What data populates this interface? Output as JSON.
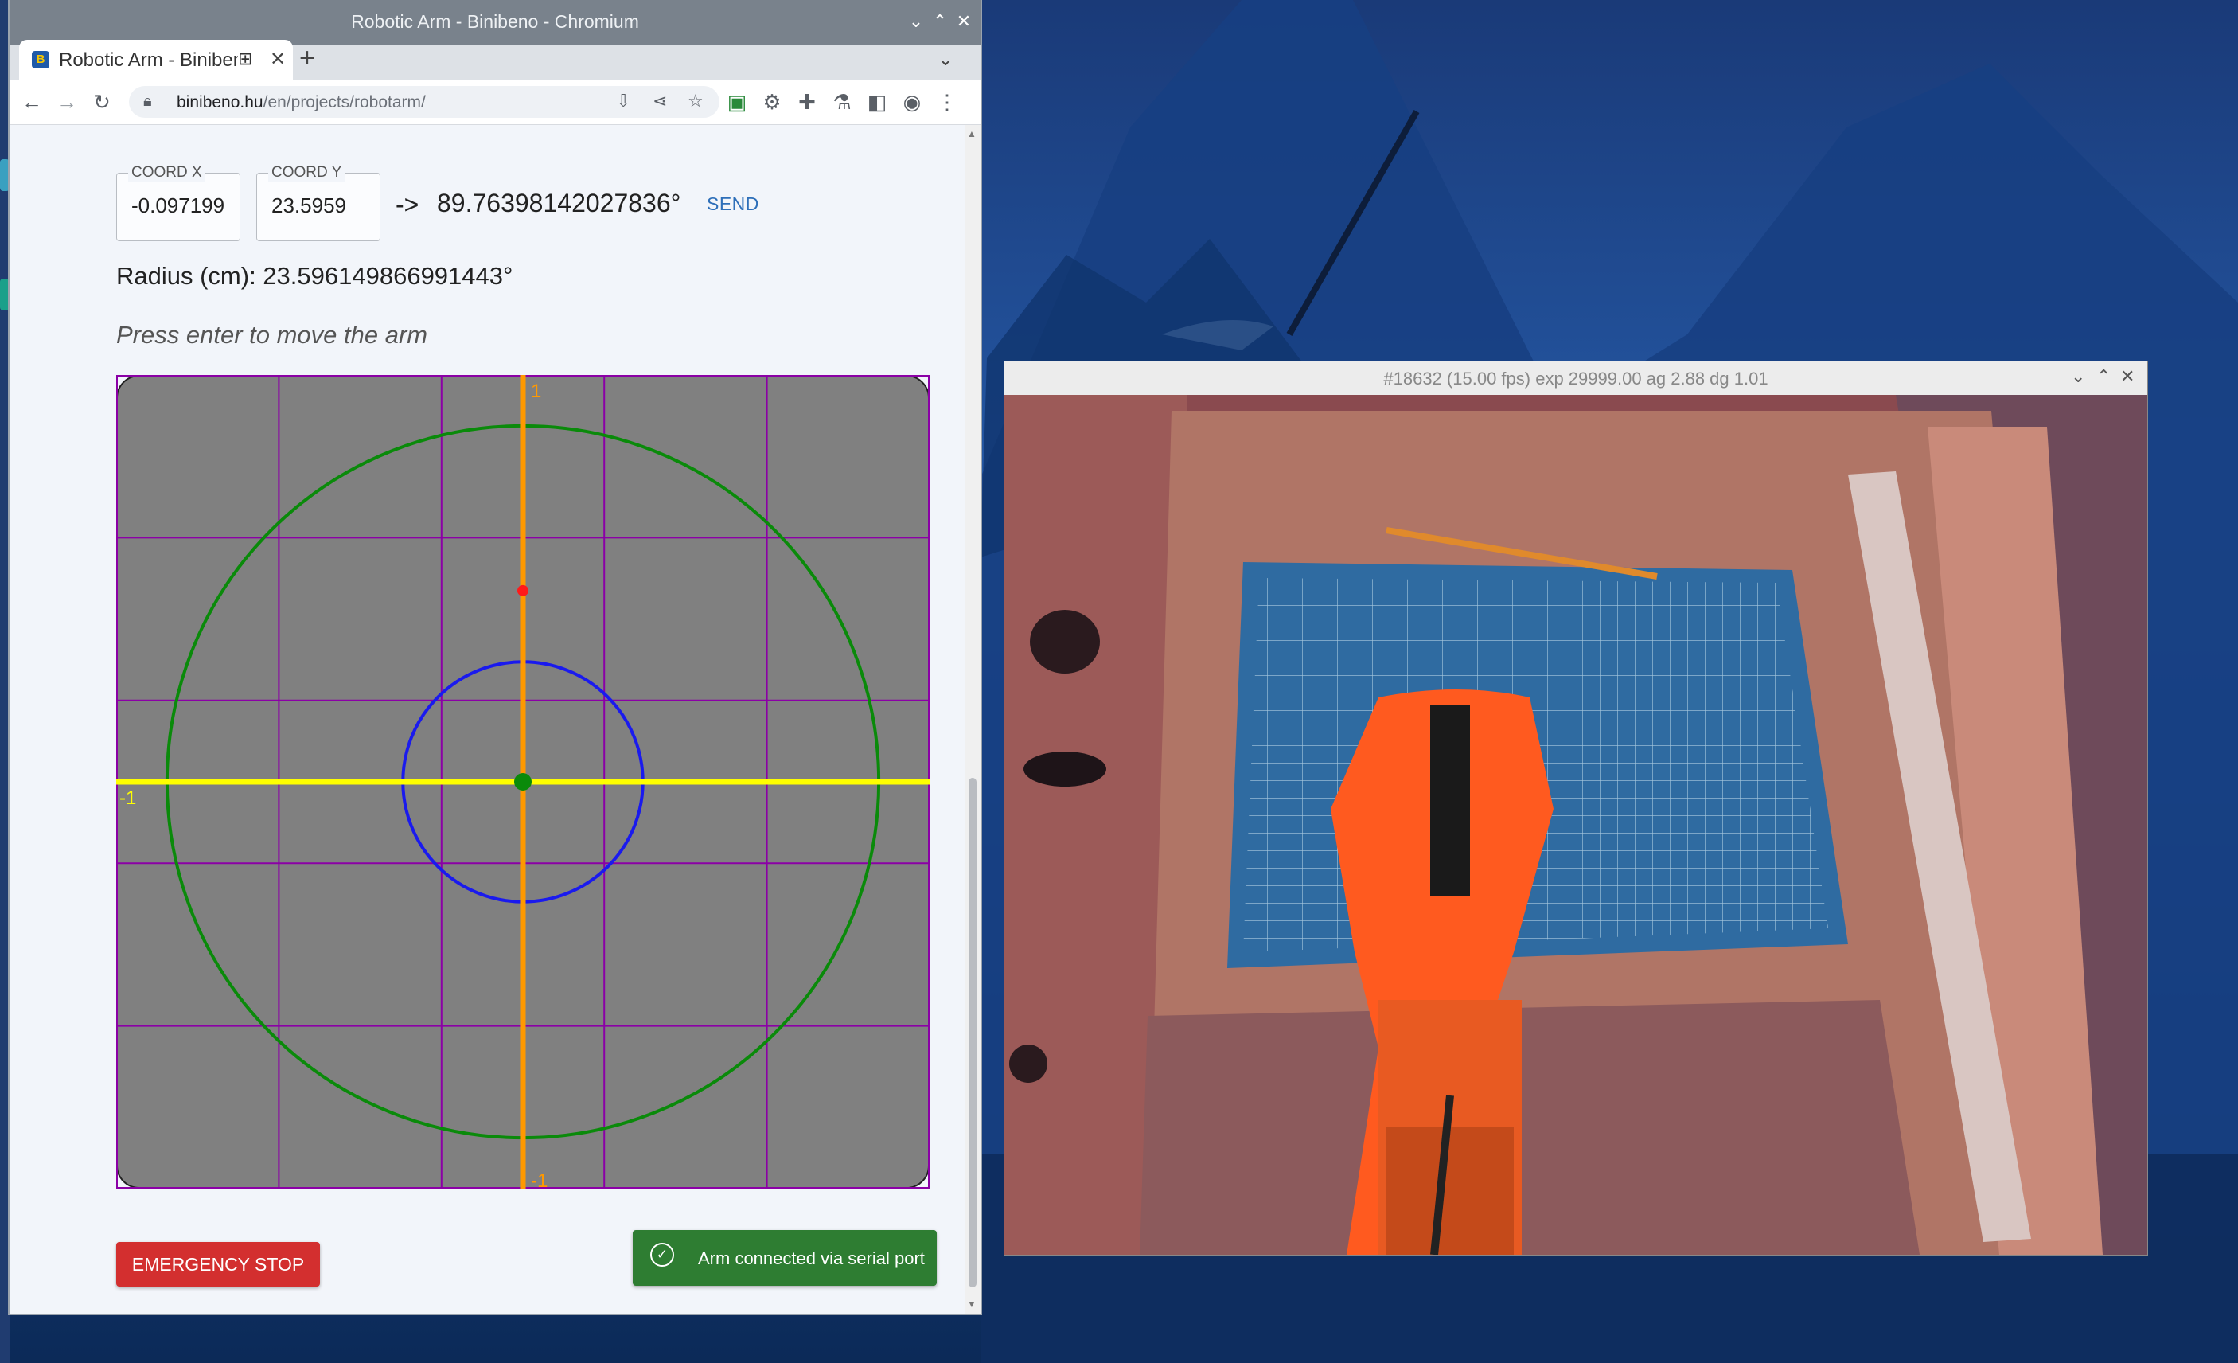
{
  "browser": {
    "window_title": "Robotic Arm - Binibeno - Chromium",
    "tab_label": "Robotic Arm - Binibeno",
    "new_tab": "+",
    "url_host": "binibeno.hu",
    "url_path": "/en/projects/robotarm/"
  },
  "controls": {
    "coord_x_label": "COORD X",
    "coord_x_value": "-0.097199",
    "coord_y_label": "COORD Y",
    "coord_y_value": "23.5959",
    "arrow": "->",
    "angle": "89.76398142027836°",
    "send_label": "SEND",
    "radius": "Radius (cm): 23.596149866991443°",
    "hint": "Press enter to move the arm"
  },
  "plot": {
    "label_top": "1",
    "label_left": "-1",
    "label_bottom": "-1",
    "grid_divisions": 5,
    "outer_radius_fraction": 0.875,
    "inner_radius_fraction": 0.295,
    "target_point": {
      "x": 0.0,
      "y": 0.47
    },
    "colors": {
      "background": "#808080",
      "grid": "#8b00a6",
      "outer_circle": "#0a8a0a",
      "inner_circle": "#1a1aee",
      "x_axis": "#ffff00",
      "y_axis": "#ff9900",
      "target": "#ff1a1a",
      "origin": "#0a8a0a"
    }
  },
  "footer": {
    "emergency_label": "EMERGENCY STOP",
    "status_message": "Arm connected via serial port"
  },
  "camera": {
    "title": "#18632 (15.00 fps) exp 29999.00 ag 2.88 dg 1.01"
  }
}
